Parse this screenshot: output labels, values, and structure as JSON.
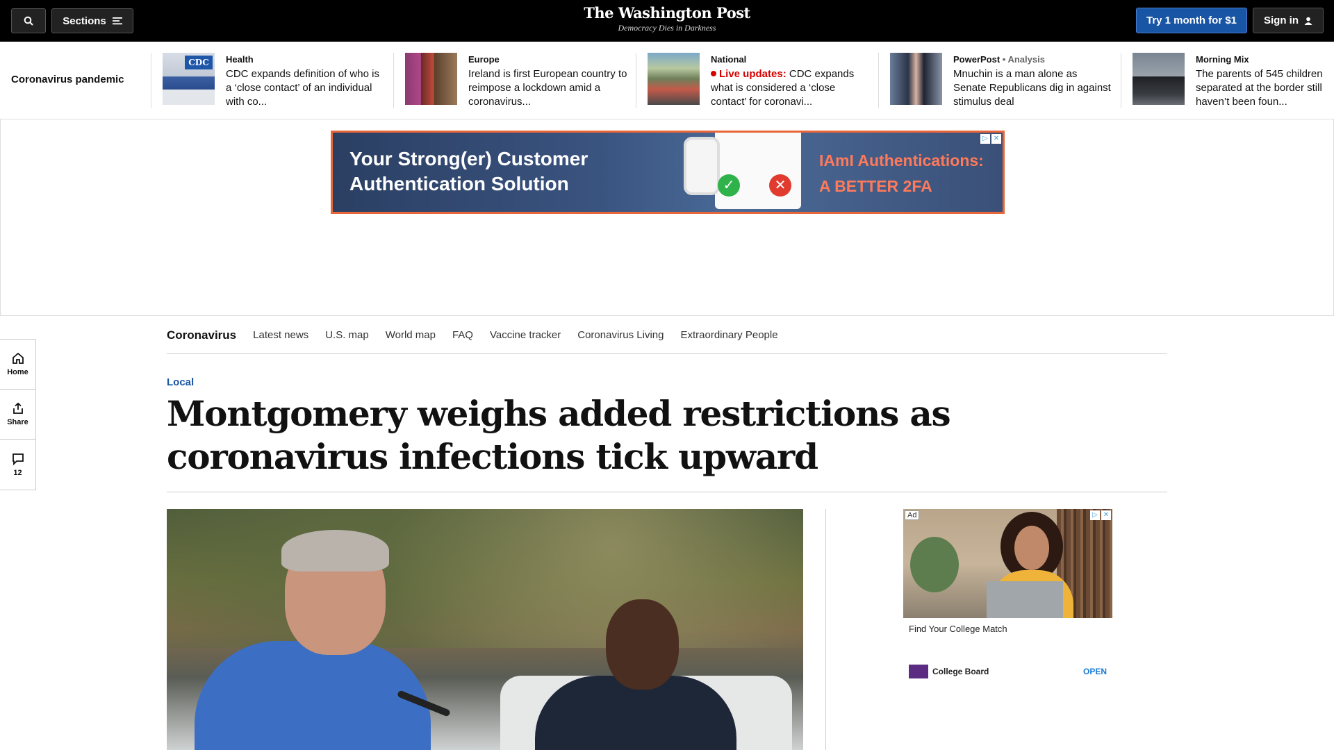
{
  "topbar": {
    "sections_label": "Sections",
    "logo_name": "The Washington Post",
    "logo_tagline": "Democracy Dies in Darkness",
    "try_label": "Try 1 month for $1",
    "signin_label": "Sign in"
  },
  "strip": {
    "label": "Coronavirus pandemic",
    "items": [
      {
        "kicker": "Health",
        "headline": "CDC expands definition of who is a ‘close contact’ of an individual with co..."
      },
      {
        "kicker": "Europe",
        "headline": "Ireland is first European country to reimpose a lockdown amid a coronavirus..."
      },
      {
        "kicker": "National",
        "live": "Live updates:",
        "headline": "CDC expands what is considered a ‘close contact’ for coronavi..."
      },
      {
        "kicker": "PowerPost",
        "kicker_extra": " • Analysis",
        "headline": "Mnuchin is a man alone as Senate Republicans dig in against stimulus deal"
      },
      {
        "kicker": "Morning Mix",
        "headline": "The parents of 545 children separated at the border still haven’t been foun..."
      }
    ]
  },
  "banner_ad": {
    "left_line1": "Your Strong(er) Customer",
    "left_line2": "Authentication Solution",
    "right_line1": "IAmI Authentications:",
    "right_line2": "A BETTER 2FA"
  },
  "rail": {
    "home": "Home",
    "share": "Share",
    "comments": "12"
  },
  "subnav": {
    "title": "Coronavirus",
    "links": [
      "Latest news",
      "U.S. map",
      "World map",
      "FAQ",
      "Vaccine tracker",
      "Coronavirus Living",
      "Extraordinary People"
    ]
  },
  "article": {
    "kicker": "Local",
    "headline": "Montgomery weighs added restrictions as coronavirus infections tick upward"
  },
  "side_ad": {
    "badge": "Ad",
    "title": "Find Your College Match",
    "advertiser": "College Board",
    "cta": "OPEN"
  },
  "colors": {
    "accent_blue": "#1955a5",
    "live_red": "#d40000",
    "banner_border": "#e8673a"
  }
}
